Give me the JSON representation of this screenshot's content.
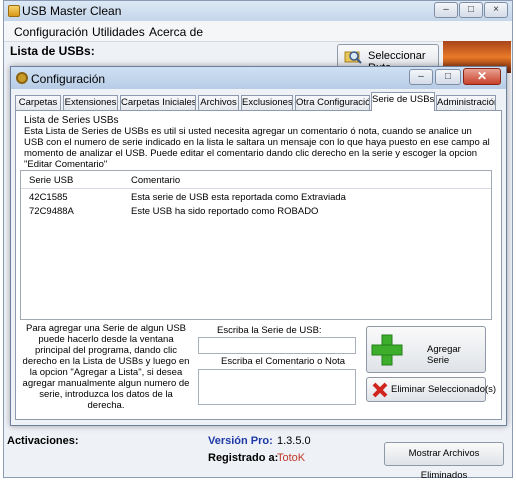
{
  "main": {
    "title": "USB Master Clean",
    "menu": [
      "Configuración",
      "Utilidades",
      "Acerca de"
    ],
    "usb_list_label": "Lista de USBs:",
    "select_path_label": "Seleccionar Ruta"
  },
  "dialog": {
    "title": "Configuración",
    "close_glyph": "✕",
    "tabs": [
      "Carpetas",
      "Extensiones",
      "Carpetas Iniciales",
      "Archivos",
      "Exclusiones",
      "Otra Configuración",
      "Serie de USBs",
      "Administración"
    ],
    "active_tab": "Serie de USBs",
    "group_label": "Lista de Series USBs",
    "description": "Esta Lista de Series de USBs es util si usted necesita agregar un comentario ó nota, cuando se analice un USB con el numero de serie indicado en la lista le saltara un mensaje con lo que haya puesto en ese campo al momento de analizar el USB. Puede editar el comentario dando clic derecho en la serie y escoger la opcion \"Editar Comentario\"",
    "columns": [
      "Serie USB",
      "Comentario"
    ],
    "rows": [
      {
        "serial": "42C1585",
        "comment": "Esta serie de USB esta reportada como Extraviada"
      },
      {
        "serial": "72C9488A",
        "comment": "Este USB ha sido reportado como ROBADO"
      }
    ],
    "help_text": "Para agregar una Serie de algun USB puede hacerlo desde la ventana principal del programa, dando clic derecho en la Lista de USBs y luego en la opcion \"Agregar a Lista\", si desea agregar manualmente algun numero de serie, introduzca los datos de la derecha.",
    "serial_label": "Escriba la Serie de USB:",
    "serial_value": "",
    "comment_label": "Escriba el Comentario o Nota",
    "comment_value": "",
    "add_button": "Agregar Serie",
    "delete_button": "Eliminar Seleccionado(s)"
  },
  "footer": {
    "activations_label": "Activaciones:",
    "version_label": "Versión Pro:",
    "version_value": "1.3.5.0",
    "registered_label": "Registrado a:",
    "registered_value": "TotoK",
    "deleted_files_button": "Mostrar Archivos Eliminados"
  },
  "colors": {
    "accent_blue": "#1f3aa8",
    "registered_red": "#c0392b",
    "add_icon_green": "#3cae2c",
    "delete_icon_red": "#d0241c"
  },
  "icons": [
    "usb-icon",
    "gear-icon",
    "search-folder-icon",
    "plus-icon",
    "delete-x-icon"
  ]
}
